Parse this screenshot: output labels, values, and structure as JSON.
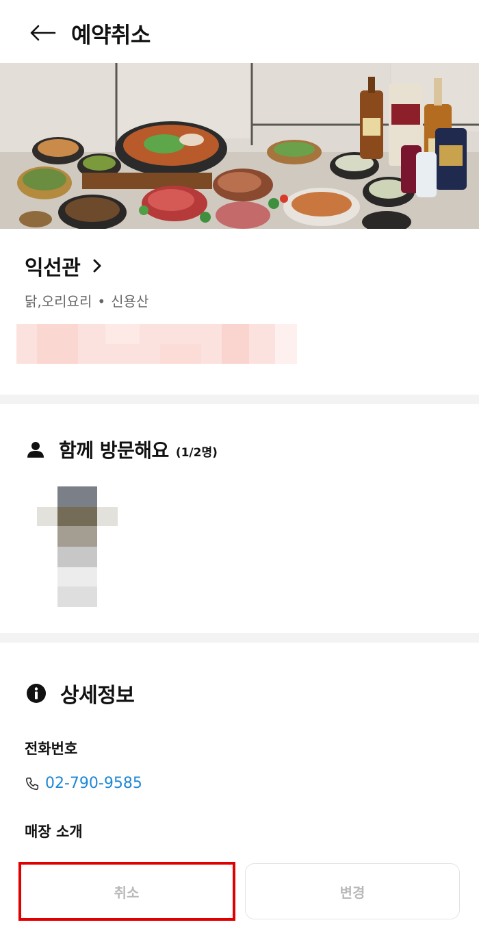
{
  "header": {
    "title": "예약취소",
    "back_icon": "arrow-left-icon"
  },
  "store": {
    "name": "익선관",
    "category": "닭,오리요리",
    "separator": "•",
    "area": "신용산"
  },
  "companions": {
    "title": "함께 방문해요",
    "count": "(1/2명)",
    "icon": "person-icon"
  },
  "details": {
    "title": "상세정보",
    "icon": "info-icon",
    "phone_label": "전화번호",
    "phone_number": "02-790-9585",
    "phone_icon": "phone-icon",
    "intro_label": "매장 소개"
  },
  "actions": {
    "cancel_label": "취소",
    "change_label": "변경"
  },
  "colors": {
    "link": "#1e88d6",
    "highlight": "#e00000",
    "disabled_text": "#b9b9b9"
  }
}
